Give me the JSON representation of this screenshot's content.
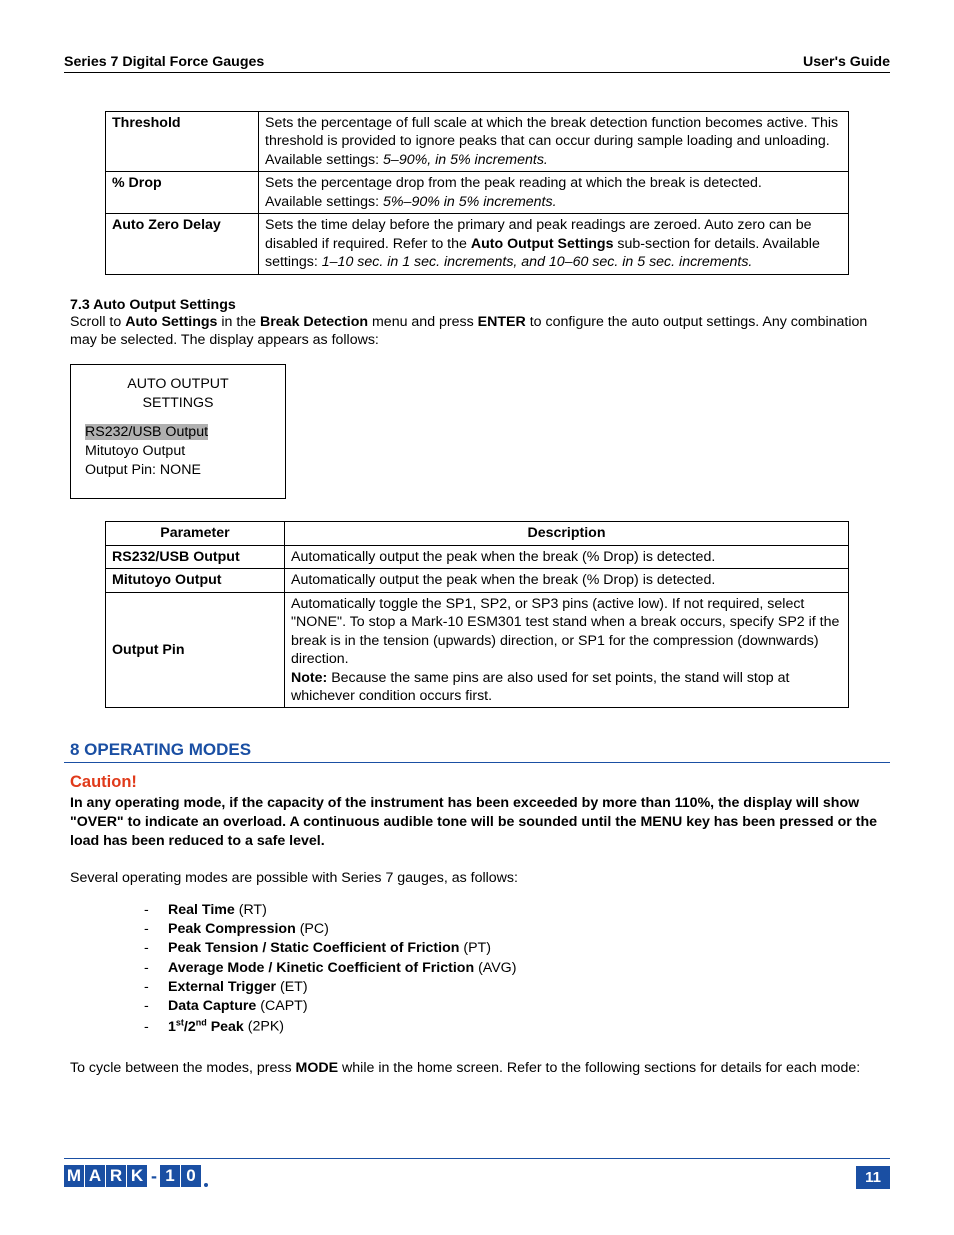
{
  "header": {
    "left": "Series 7 Digital Force Gauges",
    "right": "User's Guide"
  },
  "table1": {
    "rows": [
      {
        "label": "Threshold",
        "desc_plain": "Sets the percentage of full scale at which the break detection function becomes active. This threshold is provided to ignore peaks that can occur during sample loading and unloading.",
        "avail_prefix": "Available settings: ",
        "avail_italic": "5–90%, in 5% increments."
      },
      {
        "label": "% Drop",
        "desc_plain": "Sets the percentage drop from the peak reading at which the break is detected.",
        "avail_prefix": "Available settings: ",
        "avail_italic": "5%–90% in 5% increments."
      },
      {
        "label": "Auto Zero Delay",
        "desc_pre": "Sets the time delay before the primary and peak readings are zeroed. Auto zero can be disabled if required. Refer to the ",
        "desc_bold": "Auto Output Settings",
        "desc_post": " sub-section for details. Available settings: ",
        "desc_italic": "1–10 sec. in 1 sec. increments, and 10–60 sec. in 5 sec. increments."
      }
    ]
  },
  "section73": {
    "heading": "7.3 Auto Output Settings",
    "text_pre": "Scroll to ",
    "text_b1": "Auto Settings",
    "text_mid1": " in the ",
    "text_b2": "Break Detection",
    "text_mid2": " menu and press ",
    "text_b3": "ENTER",
    "text_post": " to configure the auto output settings. Any combination may be selected. The display appears as follows:"
  },
  "panel": {
    "line1": "AUTO OUTPUT",
    "line2": "SETTINGS",
    "opt1": "RS232/USB Output",
    "opt2": "Mitutoyo Output",
    "opt3": "Output Pin: NONE"
  },
  "table2": {
    "h1": "Parameter",
    "h2": "Description",
    "rows": [
      {
        "p": "RS232/USB Output",
        "d": "Automatically output the peak when the break (% Drop) is detected."
      },
      {
        "p": "Mitutoyo Output",
        "d": "Automatically output the peak when the break (% Drop) is detected."
      }
    ],
    "row3": {
      "p": "Output Pin",
      "d_pre": "Automatically toggle the SP1, SP2, or SP3 pins (active low). If not required, select \"NONE\". To stop a Mark-10 ESM301 test stand when a break occurs, specify SP2 if the break is in the tension (upwards) direction, or SP1 for the compression (downwards) direction.",
      "d_note_label": "Note:",
      "d_note_text": " Because the same pins are also used for set points, the stand will stop at whichever condition occurs first."
    }
  },
  "section8": {
    "heading": "8   OPERATING MODES",
    "caution": "Caution!",
    "caution_body": "In any operating mode, if the capacity of the instrument has been exceeded by more than 110%, the display will show \"OVER\" to indicate an overload. A continuous audible tone will be sounded until the MENU key has been pressed or the load has been reduced to a safe level.",
    "intro": "Several operating modes are possible with Series 7 gauges, as follows:",
    "modes": [
      {
        "b": "Real Time",
        "s": " (RT)"
      },
      {
        "b": "Peak Compression",
        "s": " (PC)"
      },
      {
        "b": "Peak Tension / Static Coefficient of Friction",
        "s": " (PT)"
      },
      {
        "b": "Average Mode / Kinetic Coefficient of Friction",
        "s": " (AVG)"
      },
      {
        "b": "External Trigger",
        "s": " (ET)"
      },
      {
        "b": "Data Capture",
        "s": " (CAPT)"
      }
    ],
    "mode_peak_pre": "1",
    "mode_peak_sup1": "st",
    "mode_peak_mid": "/2",
    "mode_peak_sup2": "nd",
    "mode_peak_post": " Peak",
    "mode_peak_suffix": " (2PK)",
    "outro_pre": "To cycle between the modes, press ",
    "outro_b": "MODE",
    "outro_post": " while in the home screen. Refer to the following sections for details for each mode:"
  },
  "footer": {
    "logo": [
      "M",
      "A",
      "R",
      "K",
      "1",
      "0"
    ],
    "page": "11"
  }
}
